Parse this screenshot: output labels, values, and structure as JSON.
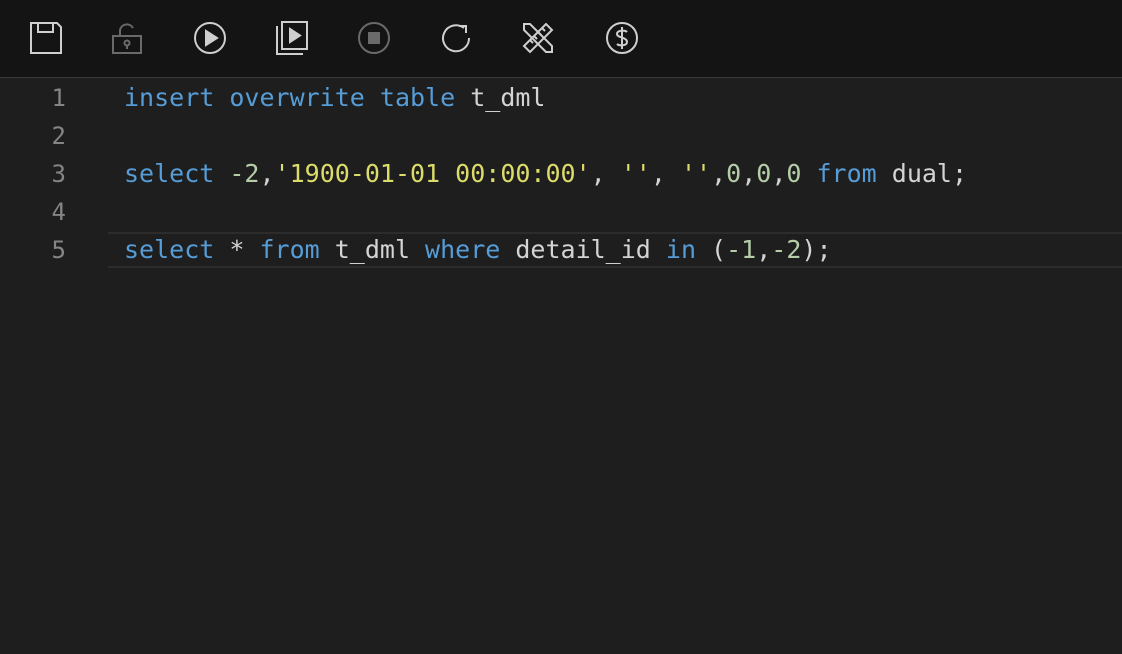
{
  "toolbar": {
    "buttons": [
      {
        "name": "save",
        "icon": "save-icon",
        "enabled": true
      },
      {
        "name": "unlock",
        "icon": "unlock-icon",
        "enabled": false
      },
      {
        "name": "run",
        "icon": "play-icon",
        "enabled": true
      },
      {
        "name": "run-script",
        "icon": "run-file-icon",
        "enabled": true
      },
      {
        "name": "stop",
        "icon": "stop-icon",
        "enabled": false
      },
      {
        "name": "refresh",
        "icon": "refresh-icon",
        "enabled": true
      },
      {
        "name": "format",
        "icon": "ruler-pencil-icon",
        "enabled": true
      },
      {
        "name": "cost",
        "icon": "dollar-icon",
        "enabled": true
      }
    ]
  },
  "colors": {
    "keyword": "#569cd6",
    "string": "#dcdc6a",
    "number": "#b5cea8",
    "text": "#d4d4d4",
    "line_number": "#858585",
    "background": "#1e1e1e",
    "toolbar": "#141414"
  },
  "editor": {
    "active_line": 5,
    "lines": [
      {
        "number": "1",
        "tokens": [
          {
            "t": "kw",
            "v": "insert"
          },
          {
            "t": "pun",
            "v": " "
          },
          {
            "t": "kw",
            "v": "overwrite"
          },
          {
            "t": "pun",
            "v": " "
          },
          {
            "t": "kw",
            "v": "table"
          },
          {
            "t": "pun",
            "v": " t_dml"
          }
        ]
      },
      {
        "number": "2",
        "tokens": []
      },
      {
        "number": "3",
        "tokens": [
          {
            "t": "kw",
            "v": "select"
          },
          {
            "t": "pun",
            "v": " "
          },
          {
            "t": "num",
            "v": "-2"
          },
          {
            "t": "pun",
            "v": ","
          },
          {
            "t": "str",
            "v": "'1900-01-01 00:00:00'"
          },
          {
            "t": "pun",
            "v": ", "
          },
          {
            "t": "str",
            "v": "''"
          },
          {
            "t": "pun",
            "v": ", "
          },
          {
            "t": "str",
            "v": "''"
          },
          {
            "t": "pun",
            "v": ","
          },
          {
            "t": "num",
            "v": "0"
          },
          {
            "t": "pun",
            "v": ","
          },
          {
            "t": "num",
            "v": "0"
          },
          {
            "t": "pun",
            "v": ","
          },
          {
            "t": "num",
            "v": "0"
          },
          {
            "t": "pun",
            "v": " "
          },
          {
            "t": "kw",
            "v": "from"
          },
          {
            "t": "pun",
            "v": " dual;"
          }
        ]
      },
      {
        "number": "4",
        "tokens": []
      },
      {
        "number": "5",
        "tokens": [
          {
            "t": "kw",
            "v": "select"
          },
          {
            "t": "pun",
            "v": " * "
          },
          {
            "t": "kw",
            "v": "from"
          },
          {
            "t": "pun",
            "v": " t_dml "
          },
          {
            "t": "kw",
            "v": "where"
          },
          {
            "t": "pun",
            "v": " detail_id "
          },
          {
            "t": "kw",
            "v": "in"
          },
          {
            "t": "pun",
            "v": " ("
          },
          {
            "t": "num",
            "v": "-1"
          },
          {
            "t": "pun",
            "v": ","
          },
          {
            "t": "num",
            "v": "-2"
          },
          {
            "t": "pun",
            "v": ");"
          }
        ]
      }
    ]
  }
}
